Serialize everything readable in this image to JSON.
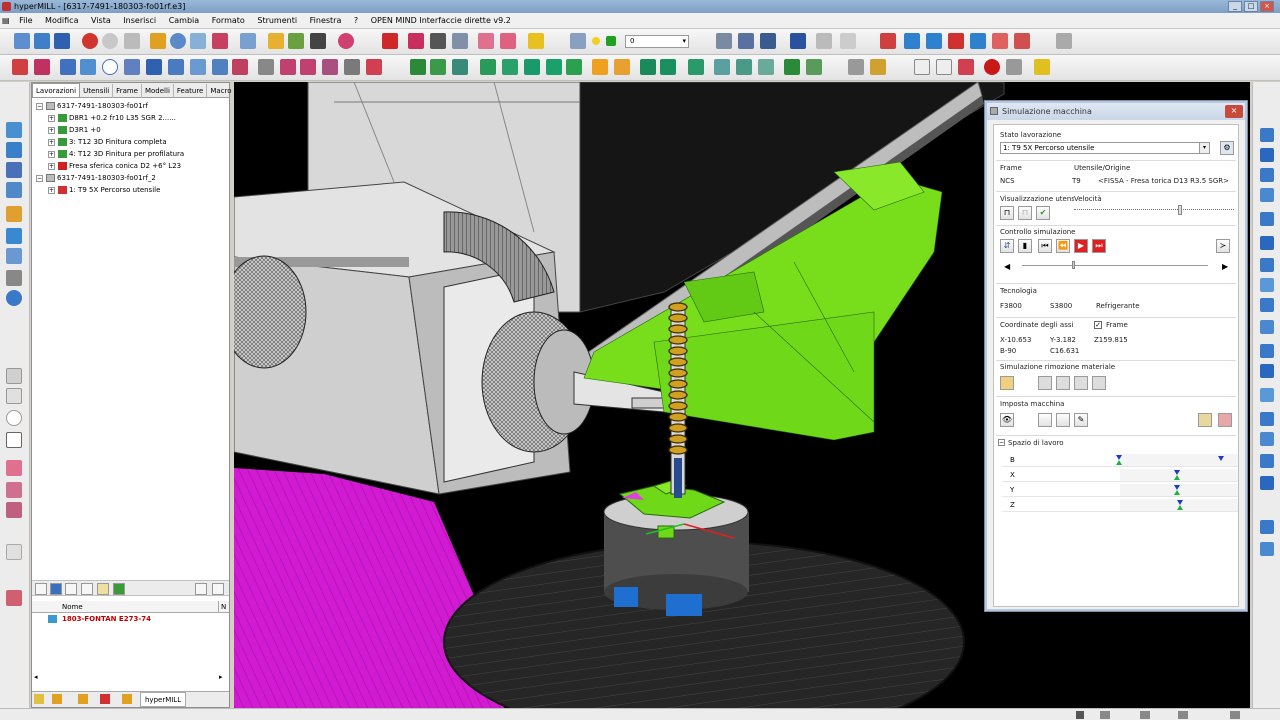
{
  "window": {
    "title": "hyperMILL - [6317-7491-180303-fo01rf.e3]"
  },
  "menu": {
    "items": [
      "File",
      "Modifica",
      "Vista",
      "Inserisci",
      "Cambia",
      "Formato",
      "Strumenti",
      "Finestra",
      "?",
      "OPEN MIND Interfaccie dirette v9.2"
    ]
  },
  "toolbar": {
    "layer_value": "0"
  },
  "browser": {
    "tabs": [
      "Lavorazioni",
      "Utensili",
      "Frame",
      "Modelli",
      "Feature",
      "Macro"
    ],
    "active_tab": "Lavorazioni",
    "tree": [
      {
        "level": 0,
        "label": "6317-7491-180303-fo01rf"
      },
      {
        "level": 1,
        "label": "D8R1 +0.2 fr10 L35 SGR 2......"
      },
      {
        "level": 1,
        "label": "D3R1 +0"
      },
      {
        "level": 1,
        "label": "3: T12 3D Finitura completa"
      },
      {
        "level": 1,
        "label": "4: T12 3D Finitura per profilatura"
      },
      {
        "level": 1,
        "label": "Fresa sferica conica D2 +6° L23"
      },
      {
        "level": 0,
        "label": "6317-7491-180303-fo01rf_2"
      },
      {
        "level": 1,
        "label": "1: T9 5X Percorso utensile"
      }
    ],
    "list_columns": [
      "Nome",
      "N"
    ],
    "list_items": [
      "1803-FONTAN E273-74"
    ],
    "bottom_tab": "hyperMILL"
  },
  "dialog": {
    "title": "Simulazione macchina",
    "stato_label": "Stato lavorazione",
    "stato_value": "1: T9 5X Percorso utensile",
    "frame_label": "Frame",
    "frame_value": "NCS",
    "utensile_label": "Utensile/Origine",
    "utensile_num": "T9",
    "utensile_value": "<FISSA - Fresa torica  D13  R3.5  SGR>",
    "vis_label": "Visualizzazione utensili",
    "velocita_label": "Velocità",
    "controllo_label": "Controllo simulazione",
    "tecnologia_label": "Tecnologia",
    "feed": "F3800",
    "speed": "S3800",
    "coolant": "Refrigerante",
    "coord_label": "Coordinate degli assi",
    "frame_check_label": "Frame",
    "coord": {
      "x": "X-10.653",
      "y": "Y-3.182",
      "z": "Z159.815",
      "b": "B-90",
      "c": "C16.631"
    },
    "rimozione_label": "Simulazione rimozione materiale",
    "imposta_label": "Imposta macchina",
    "spazio_label": "Spazio di lavoro",
    "axes": [
      "B",
      "X",
      "Y",
      "Z"
    ]
  },
  "colors": {
    "accent_green": "#7ee01e",
    "magenta": "#d21ad2",
    "play_red": "#e02020"
  }
}
